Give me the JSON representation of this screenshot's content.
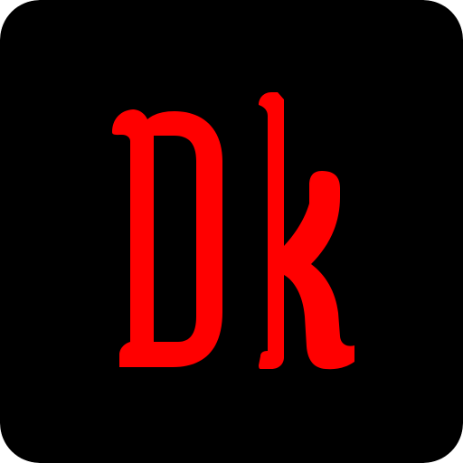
{
  "icon": {
    "logo_text": "Dk",
    "colors": {
      "background": "#000000",
      "letters": "#ff0000"
    }
  }
}
